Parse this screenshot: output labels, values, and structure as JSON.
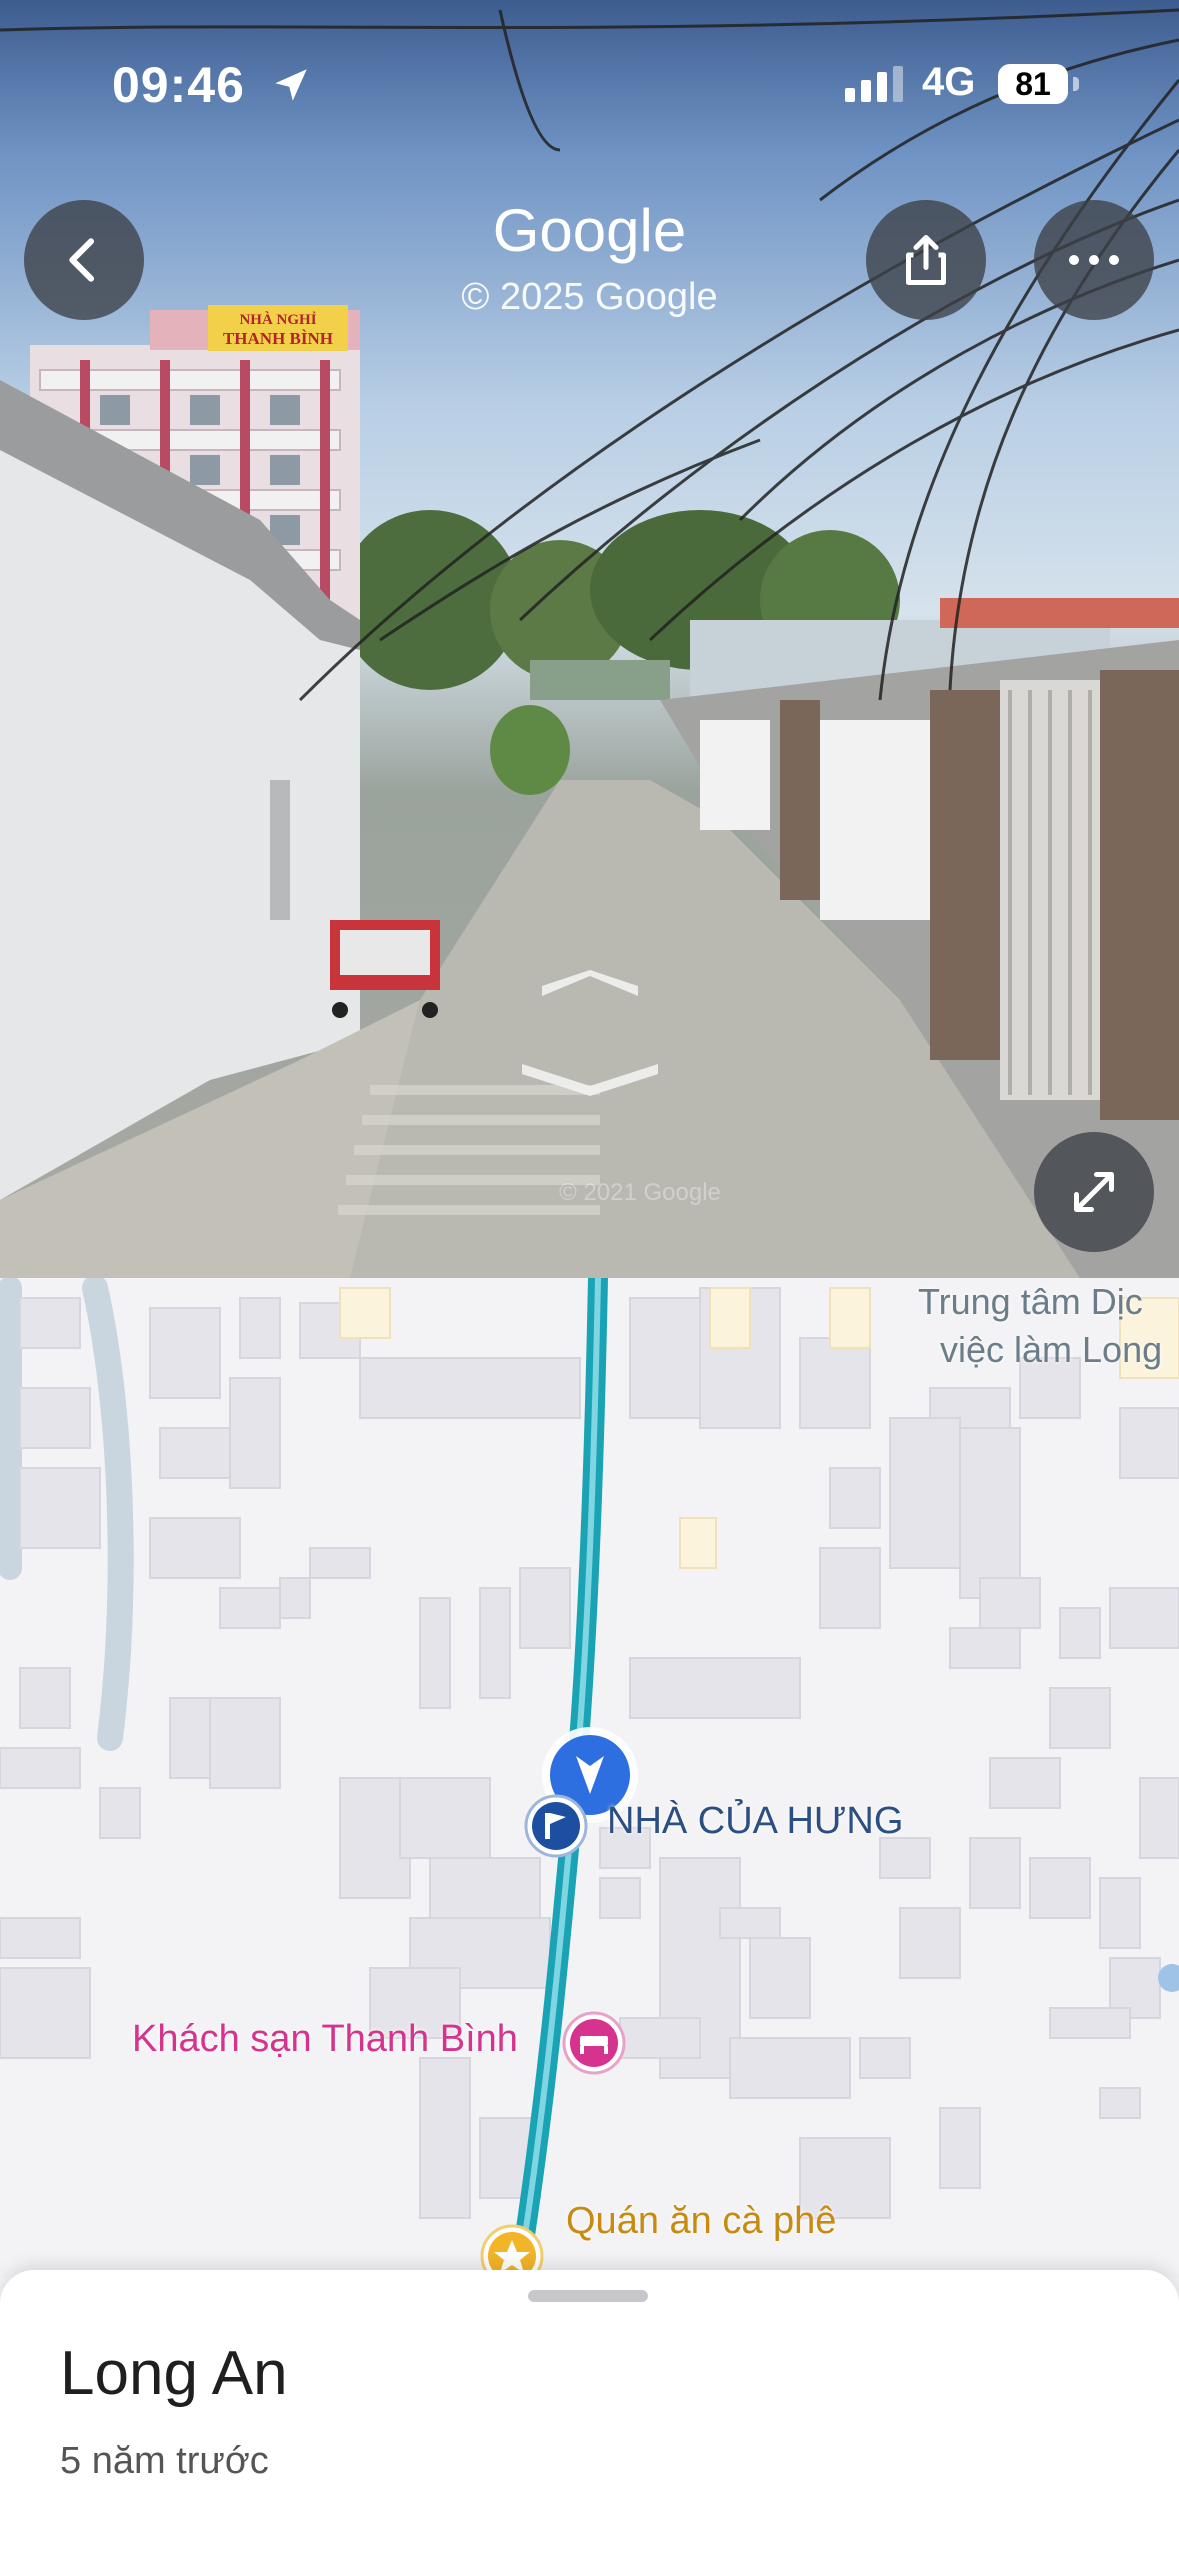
{
  "status_bar": {
    "time": "09:46",
    "network": "4G",
    "battery": "81"
  },
  "street_view": {
    "brand_title": "Google",
    "copyright": "© 2025 Google",
    "watermark": "© 2021 Google",
    "building_sign_line1": "NHÀ NGHỈ",
    "building_sign_line2": "THANH BÌNH",
    "icons": {
      "back": "chevron-left-icon",
      "share": "share-icon",
      "more": "more-horizontal-icon",
      "expand": "expand-icon"
    }
  },
  "map": {
    "poi_training_center_line1": "Trung tâm Dịc",
    "poi_training_center_line2": "việc làm Long",
    "poi_home": "NHÀ CỦA HƯNG",
    "poi_hotel": "Khách sạn Thanh Bình",
    "poi_cafe": "Quán ăn cà phê",
    "colors": {
      "route": "#1aa3b5",
      "hotel": "#d6338f",
      "cafe": "#c88a10",
      "home": "#1c4fa0",
      "position": "#2d6fe0"
    }
  },
  "bottom_sheet": {
    "title": "Long An",
    "subtitle": "5 năm trước"
  }
}
